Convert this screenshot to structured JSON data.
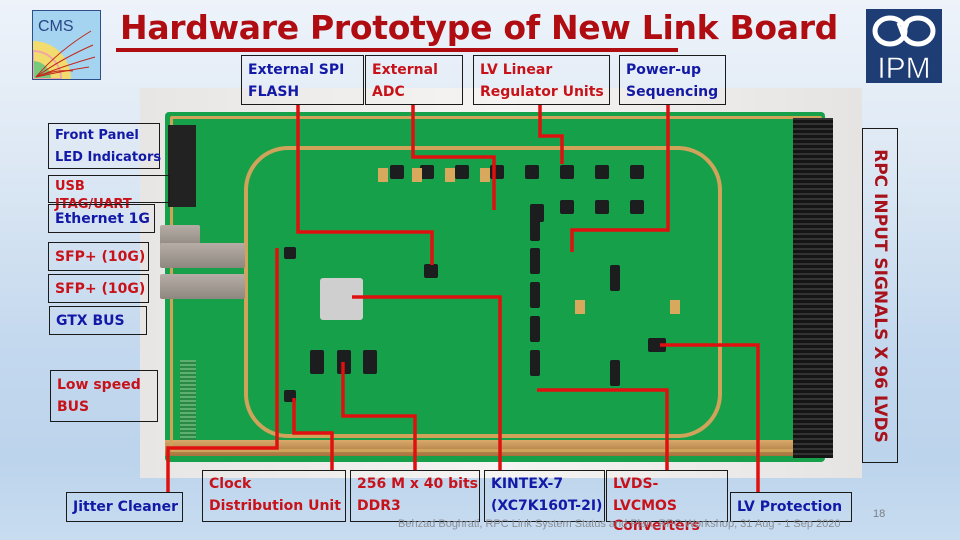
{
  "slide": {
    "title": "Hardware Prototype of New Link Board",
    "page_number": "18",
    "footer": "Behzad Boghrati, RPC Link System Status and Plan, RPC Workshop, 31 Aug - 1 Sep 2020"
  },
  "logos": {
    "left": "CMS",
    "right": "IPM"
  },
  "colors": {
    "title": "#b00d12",
    "label_blue": "#1219a6",
    "label_red": "#c8121a",
    "leader_line": "#e01010",
    "pcb": "#16a04a"
  },
  "labels": {
    "top": [
      {
        "line1": "External SPI",
        "line2": "FLASH",
        "color": "blue"
      },
      {
        "line1": "External",
        "line2": "ADC",
        "color": "red"
      },
      {
        "line1": "LV Linear",
        "line2": "Regulator Units",
        "color": "red"
      },
      {
        "line1": "Power-up",
        "line2": "Sequencing",
        "color": "blue"
      }
    ],
    "left": [
      {
        "line1": "Front Panel",
        "line2": "LED Indicators",
        "color": "blue"
      },
      {
        "line1": "USB",
        "line2": "JTAG/UART",
        "color": "red"
      },
      {
        "line1": "Ethernet 1G",
        "color": "blue"
      },
      {
        "line1": "SFP+ (10G)",
        "color": "red"
      },
      {
        "line1": "SFP+ (10G)",
        "color": "red"
      },
      {
        "line1": "GTX BUS",
        "color": "blue"
      },
      {
        "line1": "Low speed",
        "line2": "BUS",
        "color": "red"
      }
    ],
    "bottom": [
      {
        "line1": "Jitter Cleaner",
        "color": "blue"
      },
      {
        "line1": "Clock",
        "line2": "Distribution Unit",
        "color": "red"
      },
      {
        "line1": "256 M x 40 bits",
        "line2": "DDR3",
        "color": "red"
      },
      {
        "line1": "KINTEX-7",
        "line2": "(XC7K160T-2I)",
        "color": "blue"
      },
      {
        "line1": "LVDS-",
        "line2": "LVCMOS",
        "line3": "Converters",
        "color": "red"
      },
      {
        "line1": "LV Protection",
        "color": "blue"
      }
    ],
    "right_vertical": "RPC INPUT SIGNALS X 96 LVDS"
  }
}
